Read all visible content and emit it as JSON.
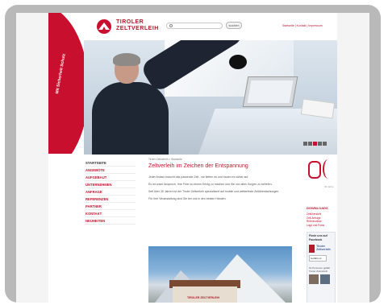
{
  "header": {
    "brand_line1": "TIROLER",
    "brand_line2": "ZELTVERLEIH",
    "search_placeholder": "",
    "search_button": "suchen",
    "top_links": "Startseite | Kontakt | Impressum"
  },
  "swoosh": {
    "text": "Mit Sicherheit Schutz"
  },
  "nav": {
    "items": [
      "STARTSEITE",
      "ANGEBOTE",
      "AUFGEBAUT",
      "UNTERNEHMEN",
      "ANFRAGE",
      "REFERENZEN",
      "PARTNER",
      "KONTAKT",
      "NEUHEITEN"
    ]
  },
  "main": {
    "breadcrumb": "Tiroler Zeltverleih > Startseite",
    "headline": "Zeltverleih im Zeichen der Entspannung",
    "paragraphs": [
      "Jeder Anlass braucht das passende Zelt - wir liefern es und bauen es sicher auf.",
      "Es ist unser Anspruch, Ihre Feier zu einem Erfolg zu machen und Sie von allen Sorgen zu befreien.",
      "Seit über 30 Jahren ist der Tiroler Zeltverleih spezialisiert auf mobile und wetterfeste Zeltüberdachungen.",
      "Für Ihre Veranstaltung sind Sie bei uns in den besten Händen."
    ]
  },
  "photo": {
    "sign_text": "TIROLER ZELTVERLEIH"
  },
  "sidebar": {
    "logo_caption": "30 Jahre",
    "downloads_title": "DOWNLOADS",
    "downloads": [
      "Zeltübersicht",
      "Zelt-Anfrage",
      "Referenzliste",
      "Logo und Fotos"
    ],
    "facebook": {
      "title": "Finde uns auf Facebook",
      "page_name": "Tiroler Zeltverleih",
      "like_label": "Gefällt mir",
      "count_text": "61 Personen gefällt Tiroler Zeltverleih"
    }
  },
  "colors": {
    "accent": "#c8102e",
    "frame": "#b9b9b9"
  }
}
